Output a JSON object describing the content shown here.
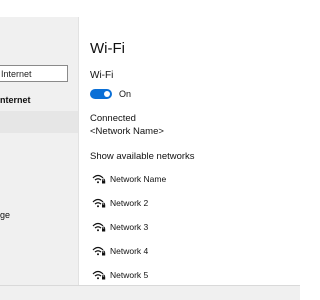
{
  "colors": {
    "accent": "#0a6fd6",
    "left_pane_background": "#f0f0f0",
    "selected_item_background": "#e6e6e6"
  },
  "sidebar": {
    "search": {
      "value": "Internet"
    },
    "items": [
      {
        "label": "nternet",
        "bold": true
      },
      {
        "label": "",
        "selected": true
      },
      {
        "label": "ge"
      }
    ]
  },
  "main": {
    "title": "Wi-Fi",
    "wifi_section_label": "Wi-Fi",
    "toggle": {
      "state_label": "On",
      "is_on": true
    },
    "connection": {
      "status": "Connected",
      "network": "<Network Name>"
    },
    "show_networks_label": "Show available networks",
    "networks": [
      {
        "name": "Network Name",
        "icon": "wifi-secured-icon"
      },
      {
        "name": "Network 2",
        "icon": "wifi-secured-icon"
      },
      {
        "name": "Network 3",
        "icon": "wifi-secured-icon"
      },
      {
        "name": "Network 4",
        "icon": "wifi-secured-icon"
      },
      {
        "name": "Network 5",
        "icon": "wifi-secured-icon"
      }
    ]
  }
}
